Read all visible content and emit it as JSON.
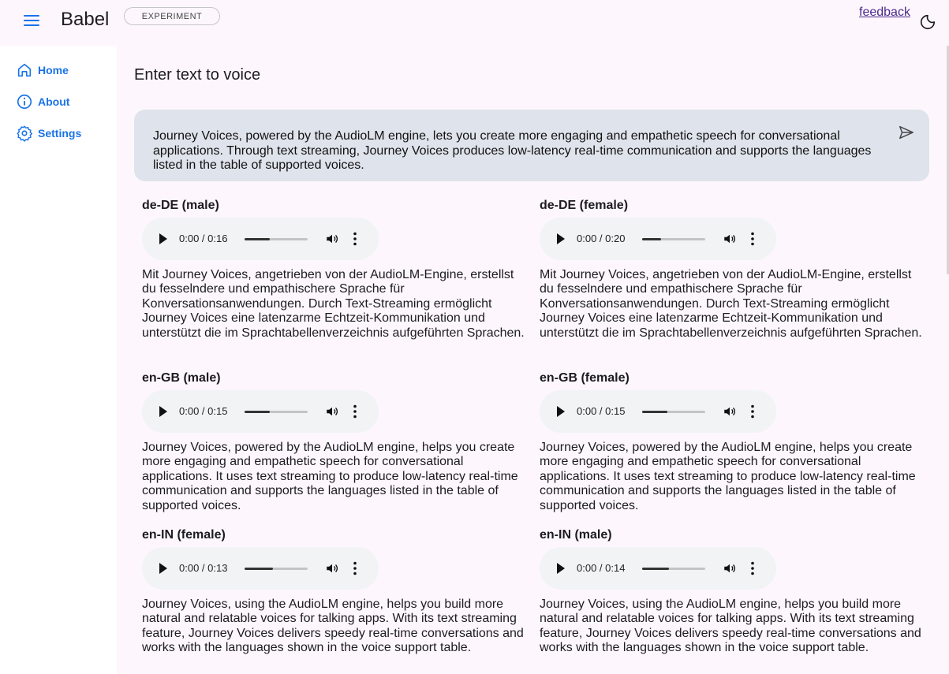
{
  "header": {
    "app_title": "Babel",
    "badge": "EXPERIMENT",
    "feedback": "feedback",
    "menu_icon": "menu-icon",
    "theme_icon": "dark-mode-icon"
  },
  "sidebar": {
    "items": [
      {
        "label": "Home",
        "icon": "home-icon"
      },
      {
        "label": "About",
        "icon": "info-icon"
      },
      {
        "label": "Settings",
        "icon": "gear-icon"
      }
    ]
  },
  "colors": {
    "accent": "#1a73e8",
    "input_bg": "#dfe3eb",
    "page_bg": "#fdf7fd"
  },
  "main": {
    "title": "Enter text to voice",
    "input_text": "Journey Voices, powered by the AudioLM engine, lets you create more engaging and empathetic speech for conversational applications. Through text streaming, Journey Voices produces low-latency real-time communication and supports the languages listed in the table of supported voices.",
    "send_icon": "send-icon"
  },
  "voices": [
    {
      "name": "de-DE (male)",
      "time": "0:00 / 0:16",
      "progress": 0.4,
      "description": "Mit Journey Voices, angetrieben von der AudioLM-Engine, erstellst du fesselndere und empathischere Sprache für Konversationsanwendungen. Durch Text-Streaming ermöglicht Journey Voices eine latenzarme Echtzeit-Kommunikation und unterstützt die im Sprachtabellenverzeichnis aufgeführten Sprachen."
    },
    {
      "name": "de-DE (female)",
      "time": "0:00 / 0:20",
      "progress": 0.3,
      "description": "Mit Journey Voices, angetrieben von der AudioLM-Engine, erstellst du fesselndere und empathischere Sprache für Konversationsanwendungen. Durch Text-Streaming ermöglicht Journey Voices eine latenzarme Echtzeit-Kommunikation und unterstützt die im Sprachtabellenverzeichnis aufgeführten Sprachen."
    },
    {
      "name": "en-GB (male)",
      "time": "0:00 / 0:15",
      "progress": 0.4,
      "description": "Journey Voices, powered by the AudioLM engine, helps you create more engaging and empathetic speech for conversational applications. It uses text streaming to produce low-latency real-time communication and supports the languages listed in the table of supported voices."
    },
    {
      "name": "en-GB (female)",
      "time": "0:00 / 0:15",
      "progress": 0.4,
      "description": "Journey Voices, powered by the AudioLM engine, helps you create more engaging and empathetic speech for conversational applications. It uses text streaming to produce low-latency real-time communication and supports the languages listed in the table of supported voices."
    },
    {
      "name": "en-IN (female)",
      "time": "0:00 / 0:13",
      "progress": 0.45,
      "description": "Journey Voices, using the AudioLM engine, helps you build more natural and relatable voices for talking apps. With its text streaming feature, Journey Voices delivers speedy real-time conversations and works with the languages shown in the voice support table."
    },
    {
      "name": "en-IN (male)",
      "time": "0:00 / 0:14",
      "progress": 0.43,
      "description": "Journey Voices, using the AudioLM engine, helps you build more natural and relatable voices for talking apps. With its text streaming feature, Journey Voices delivers speedy real-time conversations and works with the languages shown in the voice support table."
    }
  ]
}
